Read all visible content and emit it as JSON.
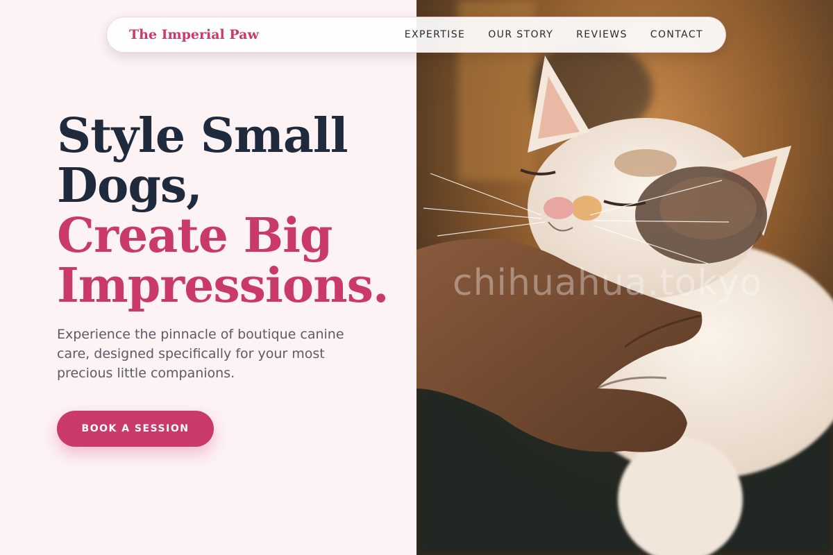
{
  "brand": {
    "name": "The Imperial Paw",
    "accent_color": "#c93a6b",
    "dark_color": "#1f2a3d"
  },
  "nav": {
    "items": [
      {
        "label": "EXPERTISE"
      },
      {
        "label": "OUR STORY"
      },
      {
        "label": "REVIEWS"
      },
      {
        "label": "CONTACT"
      }
    ]
  },
  "hero": {
    "title_lines_dark": [
      "Style Small",
      "Dogs,"
    ],
    "title_lines_accent": [
      "Create Big",
      "Impressions."
    ],
    "subtitle": "Experience the pinnacle of boutique canine care, designed specifically for your most precious little companions.",
    "cta_label": "BOOK A SESSION"
  },
  "image": {
    "watermark": "chihuahua.tokyo"
  }
}
